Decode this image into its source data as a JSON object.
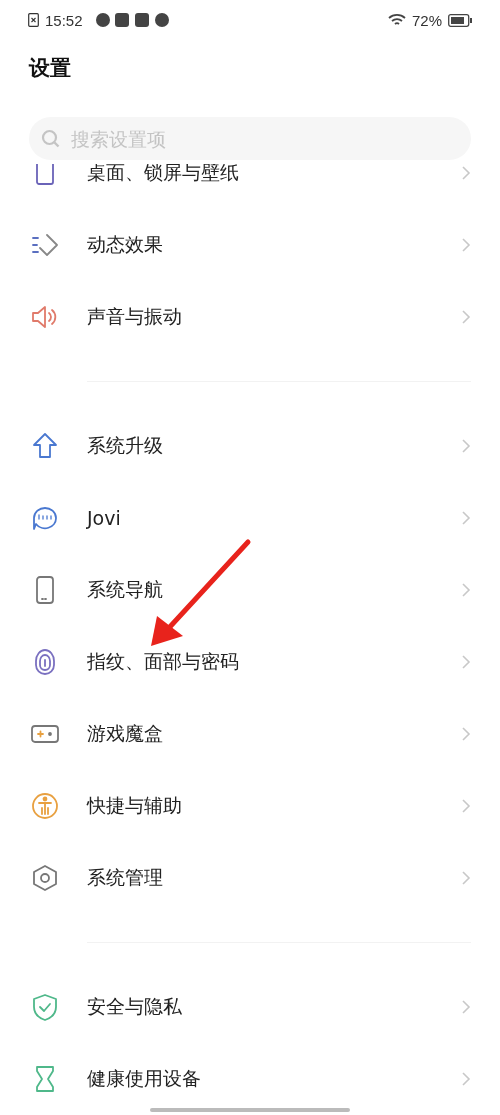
{
  "status_bar": {
    "time": "15:52",
    "battery": "72%"
  },
  "title": "设置",
  "search": {
    "placeholder": "搜索设置项"
  },
  "groups": [
    {
      "items": [
        {
          "label": "桌面、锁屏与壁纸"
        },
        {
          "label": "动态效果"
        },
        {
          "label": "声音与振动"
        }
      ]
    },
    {
      "items": [
        {
          "label": "系统升级"
        },
        {
          "label": "Jovi"
        },
        {
          "label": "系统导航"
        },
        {
          "label": "指纹、面部与密码"
        },
        {
          "label": "游戏魔盒"
        },
        {
          "label": "快捷与辅助"
        },
        {
          "label": "系统管理"
        }
      ]
    },
    {
      "items": [
        {
          "label": "安全与隐私"
        },
        {
          "label": "健康使用设备"
        }
      ]
    }
  ]
}
